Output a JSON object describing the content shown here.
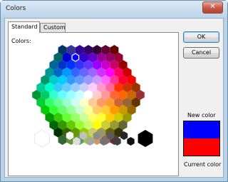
{
  "window": {
    "title": "Colors",
    "close_glyph": "✕"
  },
  "tabs": [
    {
      "label": "Standard",
      "active": true
    },
    {
      "label": "Custom",
      "active": false
    }
  ],
  "colors_label": "Colors:",
  "buttons": {
    "ok": "OK",
    "cancel": "Cancel"
  },
  "preview": {
    "new_label": "New color",
    "current_label": "Current color",
    "new_color": "#0000ff",
    "current_color": "#ff0000"
  },
  "palette": {
    "rows": [
      [
        "#003366",
        "#333399",
        "#330099",
        "#330066",
        "#330033",
        "#660033",
        "#660000"
      ],
      [
        "#006666",
        "#0000cc",
        "#0000ff",
        "#3300cc",
        "#6600cc",
        "#990099",
        "#990066",
        "#990033"
      ],
      [
        "#006699",
        "#0033cc",
        "#0033ff",
        "#3333ff",
        "#6633ff",
        "#9900ff",
        "#cc00cc",
        "#cc0066",
        "#990000"
      ],
      [
        "#009999",
        "#0066cc",
        "#0099ff",
        "#3366ff",
        "#6666ff",
        "#9966ff",
        "#cc33ff",
        "#ff00ff",
        "#ff0066",
        "#cc0000"
      ],
      [
        "#009966",
        "#00cccc",
        "#00ccff",
        "#3399ff",
        "#6699ff",
        "#9999ff",
        "#cc99ff",
        "#ff66ff",
        "#ff3399",
        "#ff0033",
        "#ff0000"
      ],
      [
        "#00cc99",
        "#00ffcc",
        "#33ccff",
        "#66ccff",
        "#99ccff",
        "#ccccff",
        "#ffccff",
        "#ff99cc",
        "#ff6699",
        "#ff3300",
        "#cc3300",
        "#993300"
      ],
      [
        "#009933",
        "#00cc66",
        "#33ffcc",
        "#66ffff",
        "#99ffff",
        "#ccffff",
        "#ffffff",
        "#ffcccc",
        "#ff9999",
        "#ff6633",
        "#ff6600",
        "#cc6600",
        "#993333"
      ],
      [
        "#00cc33",
        "#33ff66",
        "#66ff99",
        "#99ffcc",
        "#ccffee",
        "#ffffcc",
        "#ffcc99",
        "#ff9966",
        "#ff9933",
        "#cc6633",
        "#996633",
        "#663300"
      ],
      [
        "#00cc00",
        "#33ff33",
        "#66ff66",
        "#99ff99",
        "#ccffcc",
        "#ffff99",
        "#ffcc66",
        "#ffcc33",
        "#ff9900",
        "#cc9900",
        "#996600"
      ],
      [
        "#009900",
        "#33cc00",
        "#66ff33",
        "#99ff66",
        "#ccff99",
        "#ffff66",
        "#ffff33",
        "#ffcc00",
        "#cccc00",
        "#999900"
      ],
      [
        "#006600",
        "#339900",
        "#66cc00",
        "#99ff33",
        "#ccff66",
        "#ffff00",
        "#cccc33",
        "#999933",
        "#666633"
      ],
      [
        "#003300",
        "#336600",
        "#669900",
        "#99cc00",
        "#cccc66",
        "#999966",
        "#666600",
        "#333300"
      ],
      [
        "#336633",
        "#669933",
        "#669966",
        "#99cc33",
        "#cc9966",
        "#996666",
        "#663333"
      ]
    ],
    "selected_color": "#0000ff",
    "white_swatch": "#ffffff",
    "black_swatch": "#000000",
    "grays": [
      "#f8f8f8",
      "#dddddd",
      "#c0c0c0",
      "#a6a6a6",
      "#8c8c8c",
      "#737373",
      "#595959",
      "#404040",
      "#262626",
      "#111111"
    ]
  }
}
